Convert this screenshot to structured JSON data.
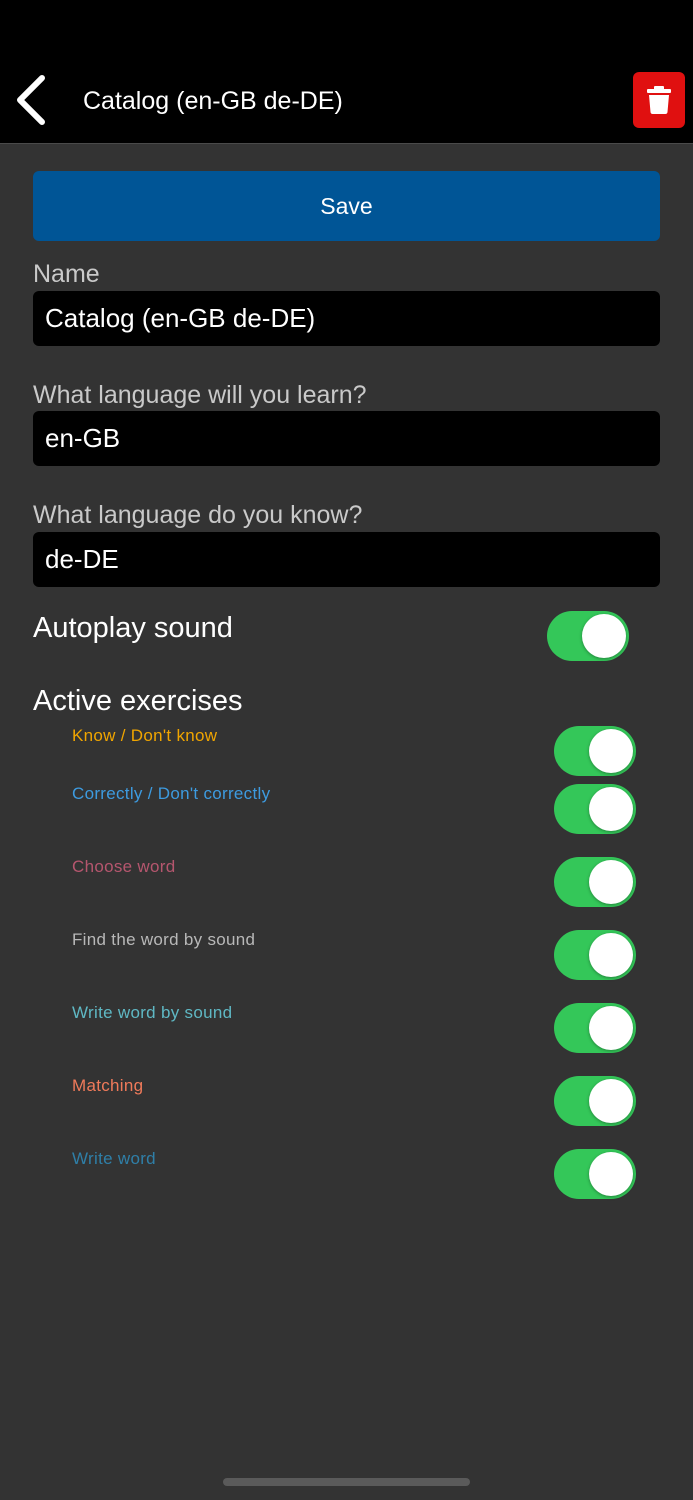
{
  "header": {
    "title": "Catalog (en-GB de-DE)",
    "back_icon": "chevron-left-icon",
    "delete_icon": "trash-icon",
    "delete_color": "#e01010"
  },
  "save": {
    "label": "Save",
    "color": "#005596"
  },
  "fields": {
    "name": {
      "label": "Name",
      "value": "Catalog (en-GB de-DE)"
    },
    "learn_language": {
      "label": "What language will you learn?",
      "value": "en-GB"
    },
    "known_language": {
      "label": "What language do you know?",
      "value": "de-DE"
    }
  },
  "autoplay": {
    "label": "Autoplay sound",
    "enabled": true
  },
  "exercises": {
    "title": "Active exercises",
    "items": [
      {
        "label": "Know / Don't know",
        "color": "#f0a500",
        "enabled": true
      },
      {
        "label": "Correctly / Don't correctly",
        "color": "#3d9be0",
        "enabled": true
      },
      {
        "label": "Choose word",
        "color": "#b5566e",
        "enabled": true
      },
      {
        "label": "Find the word by sound",
        "color": "#b8b8b8",
        "enabled": true
      },
      {
        "label": "Write word by sound",
        "color": "#5fb8c4",
        "enabled": true
      },
      {
        "label": "Matching",
        "color": "#f07a5a",
        "enabled": true
      },
      {
        "label": "Write word",
        "color": "#2f7fa8",
        "enabled": true
      }
    ]
  },
  "toggle_color": "#34c759"
}
